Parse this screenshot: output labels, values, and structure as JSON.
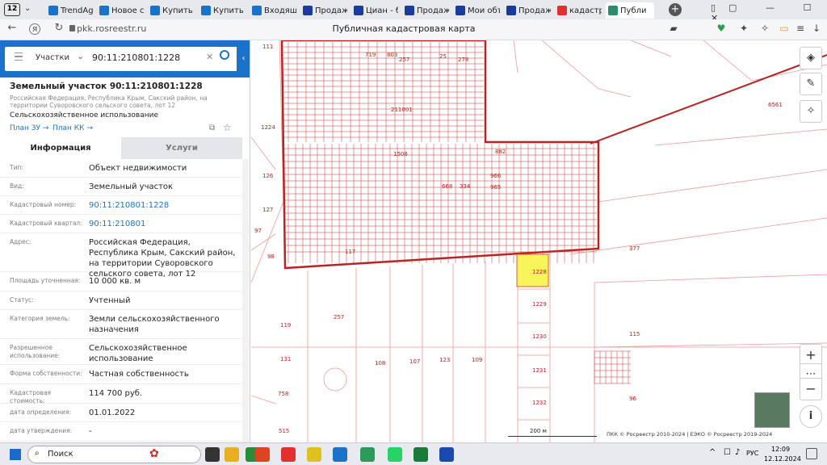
{
  "browser": {
    "tab_count": "12",
    "tabs": [
      {
        "label": "TrendAg",
        "color": "#1a73c8"
      },
      {
        "label": "Новое с",
        "color": "#1a73c8"
      },
      {
        "label": "Купить з",
        "color": "#1a73c8"
      },
      {
        "label": "Купить з",
        "color": "#1a73c8"
      },
      {
        "label": "Входящ",
        "color": "#1a73c8"
      },
      {
        "label": "Продаж",
        "color": "#1a3a9c"
      },
      {
        "label": "Циан - б",
        "color": "#1a3a9c"
      },
      {
        "label": "Продаж",
        "color": "#1a3a9c"
      },
      {
        "label": "Мои объ",
        "color": "#1a3a9c"
      },
      {
        "label": "Продаж",
        "color": "#1a3a9c"
      },
      {
        "label": "кадастр",
        "color": "#e03030"
      },
      {
        "label": "Публи",
        "color": "#2a8c6a"
      }
    ],
    "url": "pkk.rosreestr.ru",
    "page_title": "Публичная кадастровая карта"
  },
  "search": {
    "category": "Участки",
    "value": "90:11:210801:1228"
  },
  "parcel": {
    "title": "Земельный участок 90:11:210801:1228",
    "address_short": "Российская Федерация, Республика Крым, Сакский район, на территории Суворовского сельского совета, лот 12",
    "usage": "Сельскохозяйственное использование",
    "plan_zu": "План ЗУ",
    "plan_kk": "План КК"
  },
  "tabs_panel": {
    "info": "Информация",
    "services": "Услуги"
  },
  "fields": [
    {
      "label": "Тип:",
      "value": "Объект недвижимости"
    },
    {
      "label": "Вид:",
      "value": "Земельный участок"
    },
    {
      "label": "Кадастровый номер:",
      "value": "90:11:210801:1228"
    },
    {
      "label": "Кадастровый квартал:",
      "value": "90:11:210801"
    },
    {
      "label": "Адрес:",
      "value": "Российская Федерация, Республика Крым, Сакский район, на территории Суворовского сельского совета, лот 12"
    },
    {
      "label": "Площадь уточненная:",
      "value": "10 000 кв. м"
    },
    {
      "label": "Статус:",
      "value": "Учтенный"
    },
    {
      "label": "Категория земель:",
      "value": "Земли сельскохозяйственного назначения"
    },
    {
      "label": "Разрешенное использование:",
      "value": "Сельскохозяйственное использование"
    },
    {
      "label": "Форма собственности:",
      "value": "Частная собственность"
    },
    {
      "label": "Кадастровая стоимость:",
      "value": "114 700 руб."
    },
    {
      "label": "дата определения:",
      "value": "01.01.2022"
    },
    {
      "label": "дата утверждения:",
      "value": "-"
    }
  ],
  "map": {
    "labels": [
      {
        "t": "111"
      },
      {
        "t": "1224"
      },
      {
        "t": "126"
      },
      {
        "t": "127"
      },
      {
        "t": "97"
      },
      {
        "t": "98"
      },
      {
        "t": "719"
      },
      {
        "t": "803"
      },
      {
        "t": "257"
      },
      {
        "t": "25"
      },
      {
        "t": "278"
      },
      {
        "t": "1508"
      },
      {
        "t": "882"
      },
      {
        "t": "966"
      },
      {
        "t": "965"
      },
      {
        "t": "668"
      },
      {
        "t": "334"
      },
      {
        "t": "117"
      },
      {
        "t": "1228"
      },
      {
        "t": "1229"
      },
      {
        "t": "1230"
      },
      {
        "t": "1231"
      },
      {
        "t": "1232"
      },
      {
        "t": "119"
      },
      {
        "t": "257"
      },
      {
        "t": "131"
      },
      {
        "t": "108"
      },
      {
        "t": "107"
      },
      {
        "t": "123"
      },
      {
        "t": "109"
      },
      {
        "t": "758"
      },
      {
        "t": "515"
      },
      {
        "t": "377"
      },
      {
        "t": "115"
      },
      {
        "t": "96"
      },
      {
        "t": "6561"
      },
      {
        "t": "211001"
      }
    ],
    "scale": "200 м",
    "attribution": "ПКК © Росреестр 2010-2024 | ЕЭКО © Росреестр 2019-2024"
  },
  "taskbar": {
    "search": "Поиск",
    "lang": "РУС",
    "time": "12:09",
    "date": "12.12.2024"
  }
}
